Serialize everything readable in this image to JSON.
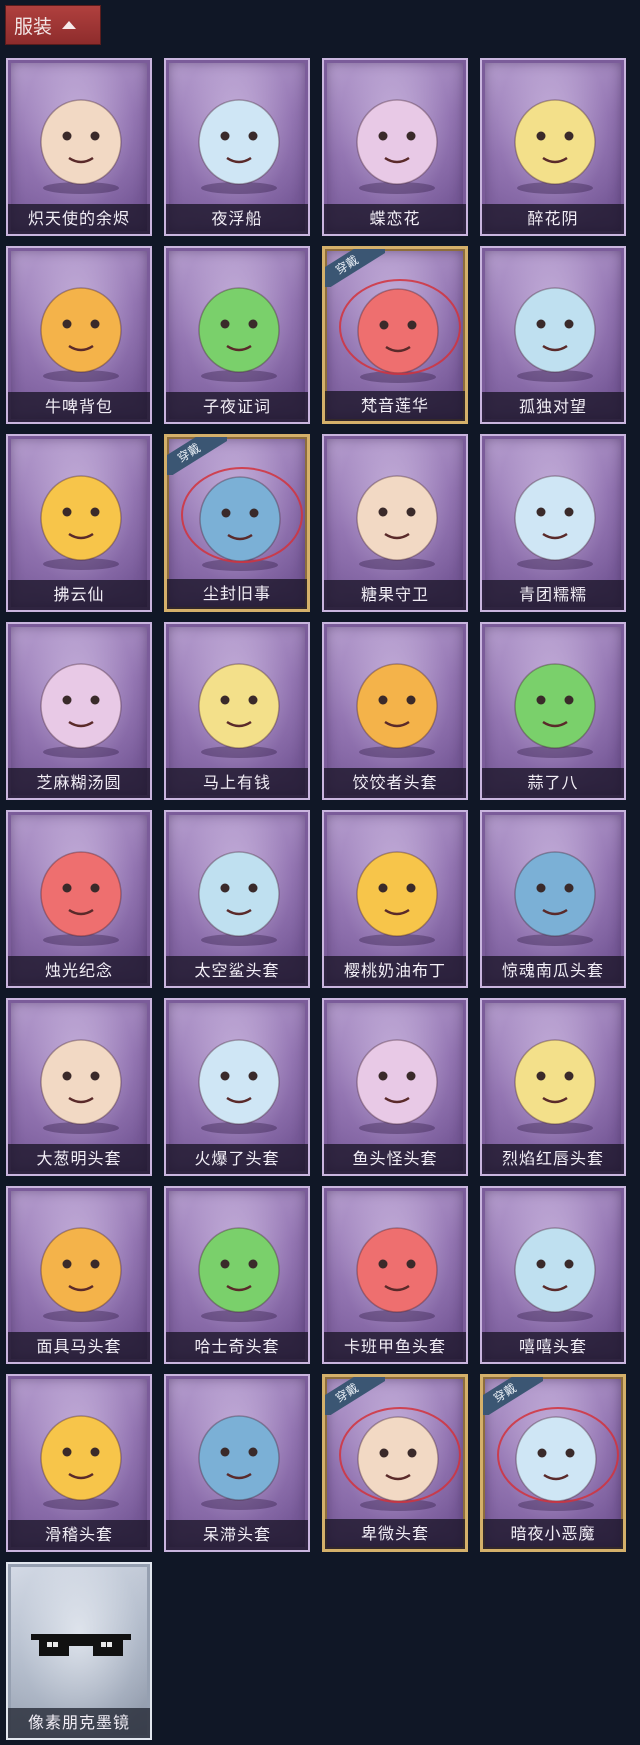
{
  "header": {
    "label": "服装"
  },
  "costumes": [
    {
      "name": "炽天使的余烬",
      "worn": false,
      "icon": "angel-icon"
    },
    {
      "name": "夜浮船",
      "worn": false,
      "icon": "jellyfish-icon"
    },
    {
      "name": "蝶恋花",
      "worn": false,
      "icon": "bell-wreath-icon"
    },
    {
      "name": "醉花阴",
      "worn": false,
      "icon": "flower-lantern-icon"
    },
    {
      "name": "牛啤背包",
      "worn": false,
      "icon": "cow-barrel-icon"
    },
    {
      "name": "子夜证词",
      "worn": false,
      "icon": "plague-bird-icon"
    },
    {
      "name": "梵音莲华",
      "worn": true,
      "icon": "lotus-girl-icon"
    },
    {
      "name": "孤独对望",
      "worn": false,
      "icon": "white-hair-doll-icon"
    },
    {
      "name": "拂云仙",
      "worn": false,
      "icon": "fairy-charm-icon"
    },
    {
      "name": "尘封旧事",
      "worn": true,
      "icon": "crowned-boy-icon"
    },
    {
      "name": "糖果守卫",
      "worn": false,
      "icon": "pumpkin-scarecrow-icon"
    },
    {
      "name": "青团糯糯",
      "worn": false,
      "icon": "green-mochi-icon"
    },
    {
      "name": "芝麻糊汤圆",
      "worn": false,
      "icon": "rice-ball-icon"
    },
    {
      "name": "马上有钱",
      "worn": false,
      "icon": "red-horse-icon"
    },
    {
      "name": "饺饺者头套",
      "worn": false,
      "icon": "dumpling-cloud-icon"
    },
    {
      "name": "蒜了八",
      "worn": false,
      "icon": "garlic-icon"
    },
    {
      "name": "烛光纪念",
      "worn": false,
      "icon": "candle-icon"
    },
    {
      "name": "太空鲨头套",
      "worn": false,
      "icon": "shark-egg-icon"
    },
    {
      "name": "樱桃奶油布丁",
      "worn": false,
      "icon": "pudding-icon"
    },
    {
      "name": "惊魂南瓜头套",
      "worn": false,
      "icon": "jack-o-lantern-icon"
    },
    {
      "name": "大葱明头套",
      "worn": false,
      "icon": "scallion-icon"
    },
    {
      "name": "火爆了头套",
      "worn": false,
      "icon": "fire-face-icon"
    },
    {
      "name": "鱼头怪头套",
      "worn": false,
      "icon": "fish-head-icon"
    },
    {
      "name": "烈焰红唇头套",
      "worn": false,
      "icon": "yellow-mouse-icon"
    },
    {
      "name": "面具马头套",
      "worn": false,
      "icon": "horse-mask-icon"
    },
    {
      "name": "哈士奇头套",
      "worn": false,
      "icon": "husky-icon"
    },
    {
      "name": "卡班甲鱼头套",
      "worn": false,
      "icon": "pufferfish-icon"
    },
    {
      "name": "嘻嘻头套",
      "worn": false,
      "icon": "grin-emoji-icon"
    },
    {
      "name": "滑稽头套",
      "worn": false,
      "icon": "sly-emoji-icon"
    },
    {
      "name": "呆滞头套",
      "worn": false,
      "icon": "dazed-emoji-icon"
    },
    {
      "name": "卑微头套",
      "worn": true,
      "icon": "humble-emoji-icon"
    },
    {
      "name": "暗夜小恶魔",
      "worn": true,
      "icon": "little-devil-icon"
    },
    {
      "name": "像素朋克墨镜",
      "worn": false,
      "icon": "pixel-sunglasses-icon",
      "special": true
    }
  ],
  "badge_text": "穿戴",
  "colors": {
    "header": "#9e3434",
    "card": "#8e70ad",
    "worn_border": "#d4b06a",
    "worn_badge": "#3b5673",
    "background": "#101726"
  }
}
